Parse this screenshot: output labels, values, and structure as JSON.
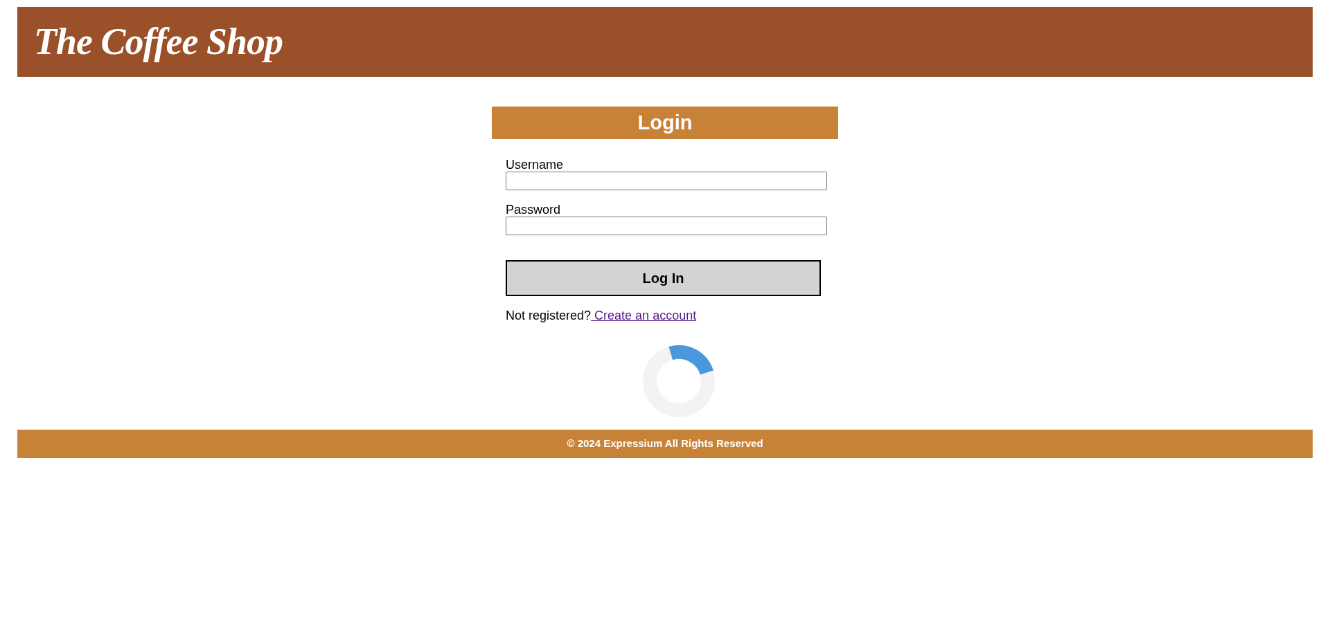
{
  "header": {
    "logo": "The Coffee Shop"
  },
  "login": {
    "title": "Login",
    "fields": [
      {
        "label": "Username"
      },
      {
        "label": "Password"
      }
    ],
    "button": "Log In",
    "register_prompt": "Not registered?",
    "register_link": " Create an account"
  },
  "footer": {
    "text": "© 2024 Expressium All Rights Reserved"
  }
}
